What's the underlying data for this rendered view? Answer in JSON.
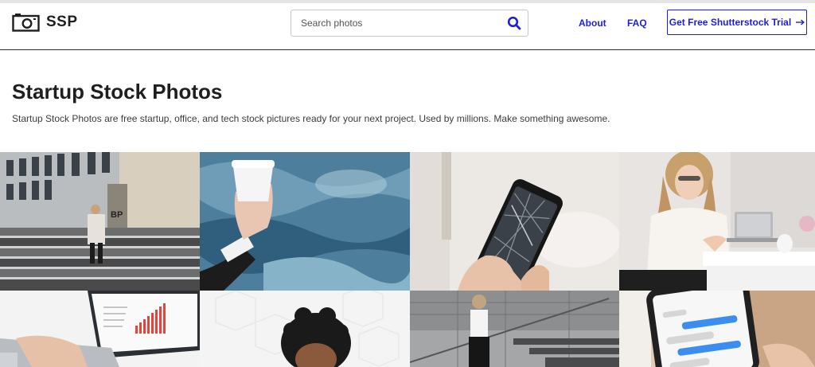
{
  "brand": {
    "logo_text": "SSP",
    "icon": "camera-icon"
  },
  "search": {
    "placeholder": "Search photos",
    "value": "",
    "icon": "search-icon"
  },
  "nav": {
    "about": "About",
    "faq": "FAQ",
    "trial": "Get Free Shutterstock Trial",
    "trial_icon": "arrow-right-icon"
  },
  "hero": {
    "title": "Startup Stock Photos",
    "description": "Startup Stock Photos are free startup, office, and tech stock pictures ready for your next project. Used by millions. Make something awesome."
  },
  "photo_tiles": [
    {
      "name": "photo-office-stairs"
    },
    {
      "name": "photo-coffee-cup-water"
    },
    {
      "name": "photo-phone-map"
    },
    {
      "name": "photo-woman-phone-desk"
    },
    {
      "name": "photo-laptop-chart"
    },
    {
      "name": "photo-curly-hair-person"
    },
    {
      "name": "photo-woman-stairs-outdoor"
    },
    {
      "name": "photo-phone-messages"
    }
  ],
  "colors": {
    "accent": "#1d1fd6",
    "text": "#1f1f1f",
    "divider": "#2b2b2b"
  }
}
